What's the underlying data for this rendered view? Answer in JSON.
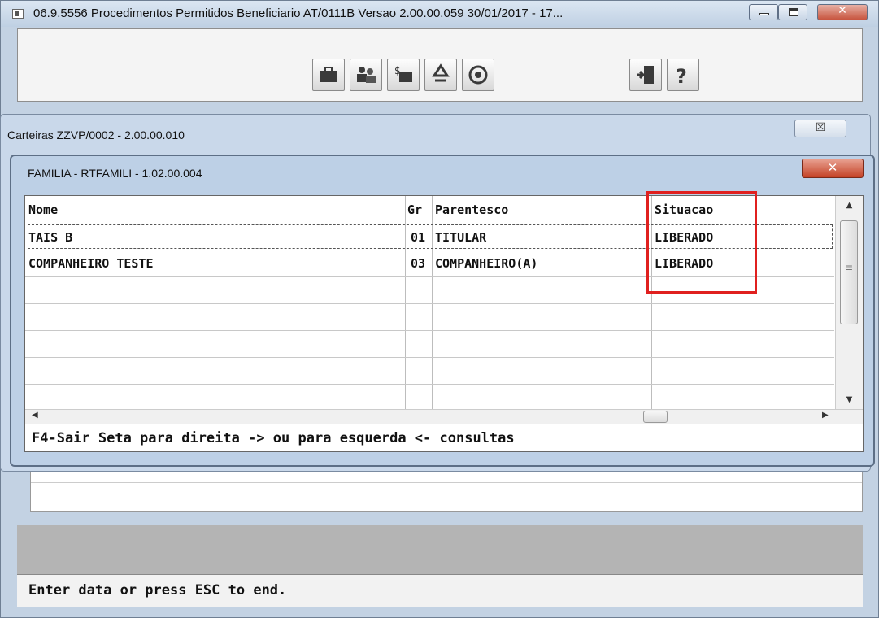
{
  "main_window": {
    "title": "06.9.5556 Procedimentos Permitidos Beneficiario AT/0111B Versao 2.00.00.059 30/01/2017 - 17...",
    "close_glyph": "✕",
    "toolbar": {
      "icons": [
        "briefcase-icon",
        "users-icon",
        "money-icon",
        "recycle-icon",
        "refresh-icon",
        "exit-door-icon",
        "help-icon"
      ]
    },
    "status_text": "Enter data or press ESC to end."
  },
  "carteiras_window": {
    "title": "Carteiras ZZVP/0002 - 2.00.00.010",
    "close_glyph": "☒"
  },
  "familia_dialog": {
    "title": "FAMILIA - RTFAMILI - 1.02.00.004",
    "close_glyph": "✕",
    "table": {
      "headers": {
        "nome": "Nome",
        "gr": "Gr",
        "parentesco": "Parentesco",
        "situacao": "Situacao"
      },
      "rows": [
        {
          "nome": "TAIS B",
          "gr": "01",
          "parentesco": "TITULAR",
          "situacao": "LIBERADO"
        },
        {
          "nome": "COMPANHEIRO TESTE",
          "gr": "03",
          "parentesco": "COMPANHEIRO(A)",
          "situacao": "LIBERADO"
        }
      ],
      "selected_row": 0,
      "highlighted_column": "situacao",
      "highlight_color": "#e0201f"
    },
    "help_text": "F4-Sair   Seta para direita -> ou para esquerda <- consultas"
  }
}
